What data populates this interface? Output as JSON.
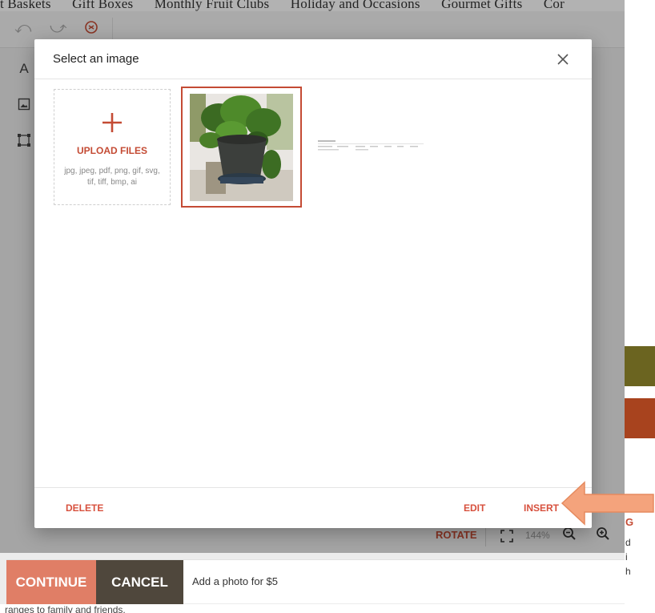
{
  "background": {
    "nav_items": [
      "t Baskets",
      "Gift Boxes",
      "Monthly Fruit Clubs",
      "Holiday and Occasions",
      "Gourmet Gifts",
      "Cor"
    ],
    "toolbar": {
      "undo_icon": "undo-icon",
      "redo_icon": "redo-icon",
      "history_icon": "history-icon"
    },
    "side_tools": [
      "A",
      "image-icon",
      "crop-frame-icon"
    ],
    "zoom": {
      "rotate_label": "ROTATE",
      "level": "144%"
    },
    "right_strip_letters": [
      "G",
      "d",
      "i",
      "h"
    ],
    "actions": {
      "continue_label": "CONTINUE",
      "cancel_label": "CANCEL",
      "photo_text": "Add a photo for $5"
    },
    "bottom_text": "ranges to family and friends."
  },
  "modal": {
    "title": "Select an image",
    "upload": {
      "label": "UPLOAD FILES",
      "formats": "jpg, jpeg, pdf, png, gif, svg, tif, tiff, bmp, ai"
    },
    "images": [
      {
        "kind": "photo",
        "selected": true,
        "subject": "potted plant"
      },
      {
        "kind": "document",
        "selected": false
      }
    ],
    "footer": {
      "delete_label": "DELETE",
      "edit_label": "EDIT",
      "insert_label": "INSERT"
    }
  },
  "colors": {
    "accent": "#c44b34",
    "continue_bg": "#e07e66",
    "cancel_bg": "#4f473c",
    "arrow": "#f4a37c"
  }
}
